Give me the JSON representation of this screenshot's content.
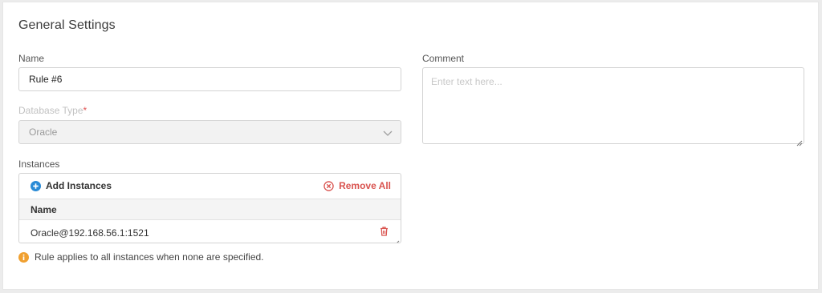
{
  "section": {
    "title": "General Settings"
  },
  "name_field": {
    "label": "Name",
    "value": "Rule #6"
  },
  "db_type": {
    "label": "Database Type",
    "required_mark": "*",
    "selected": "Oracle"
  },
  "comment": {
    "label": "Comment",
    "placeholder": "Enter text here..."
  },
  "instances": {
    "label": "Instances",
    "add_label": "Add Instances",
    "remove_all_label": "Remove All",
    "column_header": "Name",
    "rows": [
      "Oracle@192.168.56.1:1521"
    ]
  },
  "info_message": "Rule applies to all instances when none are specified.",
  "colors": {
    "accent_blue": "#2a8bd6",
    "danger_red": "#d9534f",
    "warning_orange": "#f0a030"
  },
  "icons": {
    "add": "plus-circle-icon",
    "remove_all": "x-circle-icon",
    "select": "chevron-down-icon",
    "delete_row": "trash-icon",
    "info": "info-icon"
  }
}
